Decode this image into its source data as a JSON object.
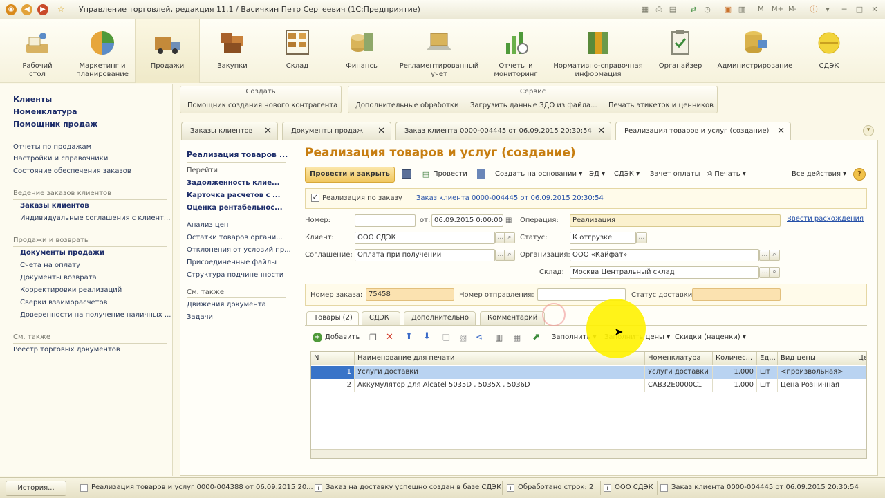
{
  "window": {
    "title": "Управление торговлей, редакция 11.1 / Васичкин Петр Сергеевич  (1С:Предприятие)",
    "tools": [
      "M",
      "M+",
      "M-"
    ]
  },
  "sections": [
    {
      "label": "Рабочий\nстол",
      "icon": "desktop-icon"
    },
    {
      "label": "Маркетинг и\nпланирование",
      "icon": "pie-chart-icon"
    },
    {
      "label": "Продажи",
      "icon": "truck-icon"
    },
    {
      "label": "Закупки",
      "icon": "boxes-icon"
    },
    {
      "label": "Склад",
      "icon": "warehouse-icon"
    },
    {
      "label": "Финансы",
      "icon": "coins-icon"
    },
    {
      "label": "Регламентированный\nучет",
      "icon": "laptop-icon"
    },
    {
      "label": "Отчеты и\nмониторинг",
      "icon": "report-icon"
    },
    {
      "label": "Нормативно-справочная\nинформация",
      "icon": "binders-icon"
    },
    {
      "label": "Органайзер",
      "icon": "clipboard-icon"
    },
    {
      "label": "Администрирование",
      "icon": "database-icon"
    },
    {
      "label": "СДЭК",
      "icon": "sdek-icon"
    }
  ],
  "leftnav": {
    "top": [
      "Клиенты",
      "Номенклатура",
      "Помощник продаж"
    ],
    "reports": [
      "Отчеты по продажам",
      "Настройки и справочники",
      "Состояние обеспечения заказов"
    ],
    "group1_title": "Ведение заказов клиентов",
    "group1": [
      "Заказы клиентов",
      "Индивидуальные соглашения с клиент..."
    ],
    "group2_title": "Продажи и возвраты",
    "group2": [
      "Документы продажи",
      "Счета на оплату",
      "Документы возврата",
      "Корректировки реализаций",
      "Сверки взаиморасчетов",
      "Доверенности на получение наличных ..."
    ],
    "see_also_title": "См. также",
    "see_also": [
      "Реестр торговых документов"
    ]
  },
  "commandbar": {
    "create_title": "Создать",
    "create_items": [
      "Помощник создания нового контрагента"
    ],
    "service_title": "Сервис",
    "service_items": [
      "Дополнительные обработки",
      "Загрузить данные ЗДО из файла...",
      "Печать этикеток и ценников"
    ]
  },
  "tabs": [
    {
      "label": "Заказы клиентов"
    },
    {
      "label": "Документы продаж"
    },
    {
      "label": "Заказ клиента 0000-004445 от 06.09.2015 20:30:54"
    },
    {
      "label": "Реализация товаров и услуг (создание)"
    }
  ],
  "innernav": {
    "title": "Реализация товаров ...",
    "goto_title": "Перейти",
    "goto": [
      "Задолженность клие...",
      "Карточка расчетов с ...",
      "Оценка рентабельнос..."
    ],
    "links": [
      "Анализ цен",
      "Остатки товаров органи...",
      "Отклонения от условий пр...",
      "Присоединенные файлы",
      "Структура подчиненности"
    ],
    "see_also_title": "См. также",
    "see_also": [
      "Движения документа",
      "Задачи"
    ]
  },
  "form": {
    "title": "Реализация товаров и услуг (создание)",
    "toolbar": {
      "post_close": "Провести и закрыть",
      "post": "Провести",
      "create_based": "Создать на основании",
      "edo": "ЭД",
      "sdek": "СДЭК",
      "payment_offset": "Зачет оплаты",
      "print": "Печать",
      "all_actions": "Все действия",
      "help": "?"
    },
    "by_order_label": "Реализация по заказу",
    "order_link": "Заказ клиента 0000-004445 от 06.09.2015 20:30:54",
    "number_label": "Номер:",
    "number_value": "",
    "date_label": "от:",
    "date_value": "06.09.2015  0:00:00",
    "operation_label": "Операция:",
    "operation_value": "Реализация",
    "discrepancy_link": "Ввести расхождения",
    "client_label": "Клиент:",
    "client_value": "ООО СДЭК",
    "status_label": "Статус:",
    "status_value": "К отгрузке",
    "agreement_label": "Соглашение:",
    "agreement_value": "Оплата при получении",
    "org_label": "Организация:",
    "org_value": "ООО «Кайфат»",
    "warehouse_label": "Склад:",
    "warehouse_value": "Москва Центральный склад",
    "order_no_label": "Номер заказа:",
    "order_no_value": "75458",
    "shipment_no_label": "Номер отправления:",
    "shipment_no_value": "",
    "delivery_status_label": "Статус доставки:",
    "delivery_status_value": ""
  },
  "inner_tabs": [
    "Товары (2)",
    "СДЭК",
    "Дополнительно",
    "Комментарий"
  ],
  "table_toolbar": {
    "add": "Добавить",
    "fill": "Заполнить",
    "fill_prices": "Заполнить цены",
    "discounts": "Скидки (наценки)"
  },
  "table": {
    "columns": [
      "N",
      "Наименование для печати",
      "Номенклатура",
      "Количес...",
      "Ед...",
      "Вид цены",
      "Це"
    ],
    "rows": [
      {
        "n": "1",
        "name": "Услуги доставки",
        "item": "Услуги доставки",
        "qty": "1,000",
        "unit": "шт",
        "price_type": "<произвольная>"
      },
      {
        "n": "2",
        "name": "Аккумулятор для Alcatel 5035D , 5035X , 5036D",
        "item": "САВ32Е0000С1",
        "qty": "1,000",
        "unit": "шт",
        "price_type": "Цена Розничная"
      }
    ]
  },
  "statusbar": {
    "history": "История...",
    "items": [
      "Реализация товаров и услуг 0000-004388 от 06.09.2015 20...",
      "Заказ на доставку успешно создан в базе СДЭК",
      "Обработано строк: 2",
      "ООО СДЭК",
      "Заказ клиента 0000-004445 от 06.09.2015 20:30:54"
    ]
  },
  "colors": {
    "accent": "#c77e10",
    "selection": "#b9d3f1",
    "highlight": "#fff200"
  }
}
